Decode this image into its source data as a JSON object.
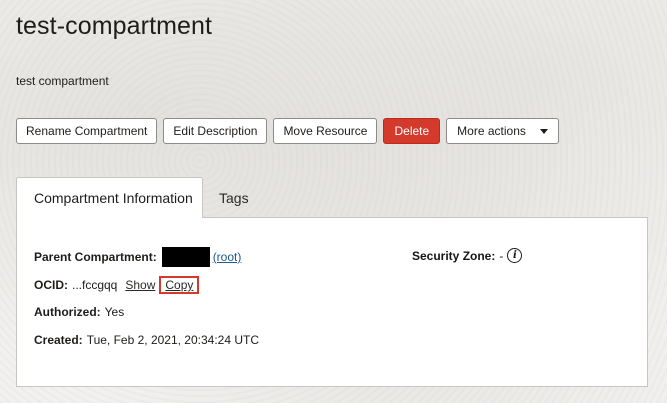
{
  "page": {
    "title": "test-compartment",
    "subtitle": "test compartment"
  },
  "toolbar": {
    "rename_label": "Rename Compartment",
    "edit_description_label": "Edit Description",
    "move_resource_label": "Move Resource",
    "delete_label": "Delete",
    "more_actions_label": "More actions"
  },
  "tabs": [
    {
      "label": "Compartment Information",
      "active": true
    },
    {
      "label": "Tags",
      "active": false
    }
  ],
  "info": {
    "parent_compartment_label": "Parent Compartment:",
    "parent_compartment_link": "(root)",
    "ocid_label": "OCID:",
    "ocid_value": "...fccgqq",
    "show_label": "Show",
    "copy_label": "Copy",
    "authorized_label": "Authorized:",
    "authorized_value": "Yes",
    "created_label": "Created:",
    "created_value": "Tue, Feb 2, 2021, 20:34:24 UTC",
    "security_zone_label": "Security Zone:",
    "security_zone_value": "-"
  },
  "icons": {
    "info": "info-icon",
    "more_actions_caret": "caret-down-icon"
  },
  "colors": {
    "delete_button": "#d33a2c",
    "link": "#1a5a8c",
    "highlight_box": "#d33a2c"
  }
}
